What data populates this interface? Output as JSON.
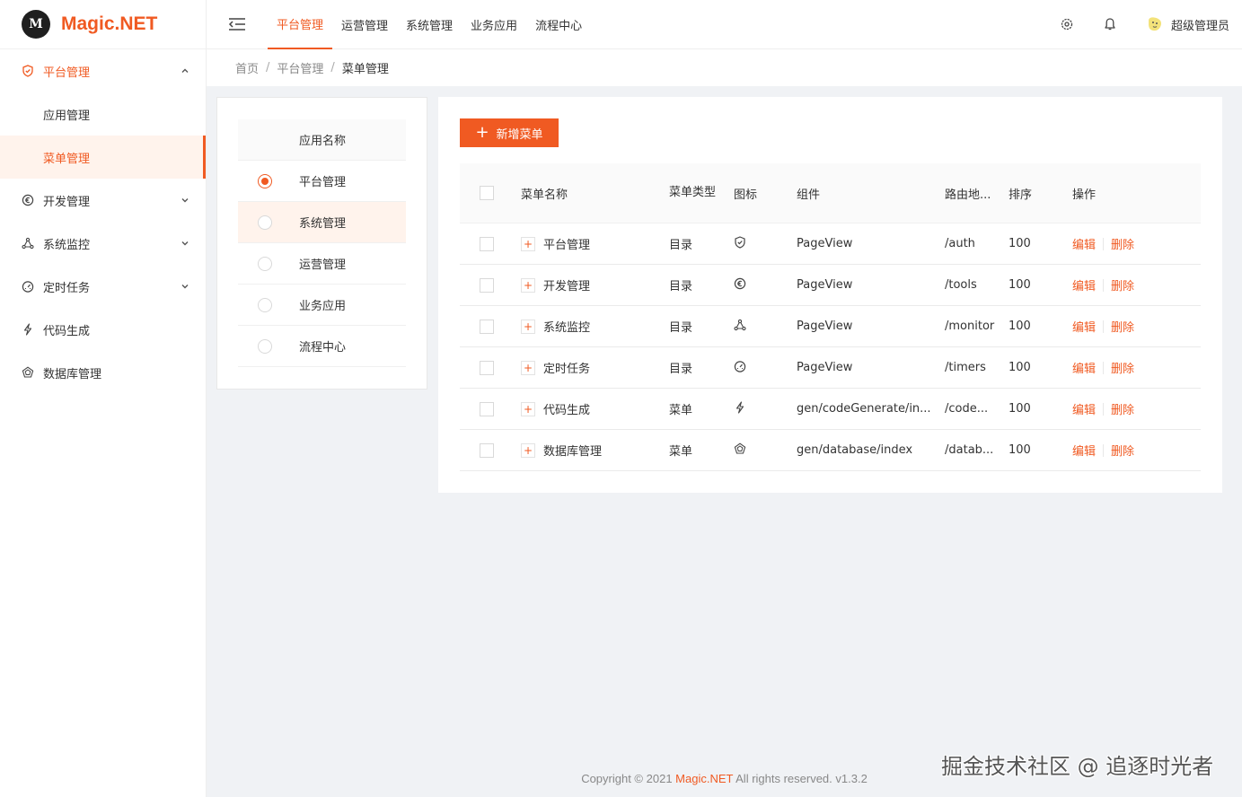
{
  "brand": {
    "name": "Magic.NET",
    "logo_mark": "M"
  },
  "sidebar": {
    "items": [
      {
        "label": "平台管理",
        "icon": "shield-icon",
        "expanded": true,
        "children": [
          {
            "label": "应用管理"
          },
          {
            "label": "菜单管理",
            "active": true
          }
        ]
      },
      {
        "label": "开发管理",
        "icon": "euro-circle-icon"
      },
      {
        "label": "系统监控",
        "icon": "cluster-icon"
      },
      {
        "label": "定时任务",
        "icon": "dashboard-icon"
      },
      {
        "label": "代码生成",
        "icon": "thunderbolt-icon"
      },
      {
        "label": "数据库管理",
        "icon": "database-icon"
      }
    ]
  },
  "header": {
    "tabs": [
      {
        "label": "平台管理",
        "active": true
      },
      {
        "label": "运营管理"
      },
      {
        "label": "系统管理"
      },
      {
        "label": "业务应用"
      },
      {
        "label": "流程中心"
      }
    ],
    "user_name": "超级管理员"
  },
  "breadcrumb": [
    "首页",
    "平台管理",
    "菜单管理"
  ],
  "app_list": {
    "header": "应用名称",
    "items": [
      {
        "label": "平台管理",
        "checked": true
      },
      {
        "label": "系统管理",
        "selected": true
      },
      {
        "label": "运营管理"
      },
      {
        "label": "业务应用"
      },
      {
        "label": "流程中心"
      }
    ]
  },
  "menu_table": {
    "add_button": "新增菜单",
    "columns": [
      "菜单名称",
      "菜单类型",
      "图标",
      "组件",
      "路由地...",
      "排序",
      "操作"
    ],
    "rows": [
      {
        "name": "平台管理",
        "type": "目录",
        "icon": "shield-icon",
        "component": "PageView",
        "route": "/auth",
        "sort": "100"
      },
      {
        "name": "开发管理",
        "type": "目录",
        "icon": "euro-circle-icon",
        "component": "PageView",
        "route": "/tools",
        "sort": "100"
      },
      {
        "name": "系统监控",
        "type": "目录",
        "icon": "cluster-icon",
        "component": "PageView",
        "route": "/monitor",
        "sort": "100"
      },
      {
        "name": "定时任务",
        "type": "目录",
        "icon": "dashboard-icon",
        "component": "PageView",
        "route": "/timers",
        "sort": "100"
      },
      {
        "name": "代码生成",
        "type": "菜单",
        "icon": "thunderbolt-icon",
        "component": "gen/codeGenerate/in...",
        "route": "/code...",
        "sort": "100"
      },
      {
        "name": "数据库管理",
        "type": "菜单",
        "icon": "database-icon",
        "component": "gen/database/index",
        "route": "/datab...",
        "sort": "100"
      }
    ],
    "edit_label": "编辑",
    "delete_label": "删除"
  },
  "footer": {
    "prefix": "Copyright © 2021 ",
    "brand": "Magic.NET",
    "suffix": " All rights reserved. v1.3.2"
  },
  "watermark": "掘金技术社区 @ 追逐时光者",
  "colors": {
    "accent": "#f05a22",
    "selected_bg": "#fff3ec"
  }
}
